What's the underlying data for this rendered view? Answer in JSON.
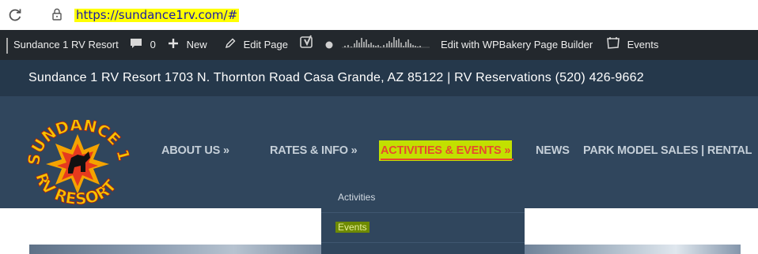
{
  "browser": {
    "url": "https://sundance1rv.com/#",
    "reload_icon": "reload-icon",
    "lock_icon": "lock-icon"
  },
  "adminbar": {
    "site_name": "Sundance 1 RV Resort",
    "comments_count": "0",
    "new_label": "New",
    "edit_page_label": "Edit Page",
    "wpbakery_label": "Edit with WPBakery Page Builder",
    "events_label": "Events"
  },
  "infobar": {
    "text": "Sundance 1 RV Resort 1703 N. Thornton Road Casa Grande, AZ 85122 | RV Reservations (520) 426-9662"
  },
  "logo": {
    "top_text": "SUNDANCE 1",
    "bottom_text": "RV RESORT"
  },
  "nav": {
    "items": [
      {
        "label": "ABOUT US »"
      },
      {
        "label": "RATES & INFO »"
      },
      {
        "label": "ACTIVITIES & EVENTS »"
      },
      {
        "label": "NEWS"
      },
      {
        "label": "PARK MODEL SALES | RENTAL"
      }
    ]
  },
  "dropdown": {
    "items": [
      {
        "label": "Activities"
      },
      {
        "label": "Events"
      }
    ]
  },
  "colors": {
    "adminbar": "#23282d",
    "infobar": "#25384b",
    "header": "#30465d",
    "accent": "#e64a2e",
    "highlight": "#c2e000"
  }
}
